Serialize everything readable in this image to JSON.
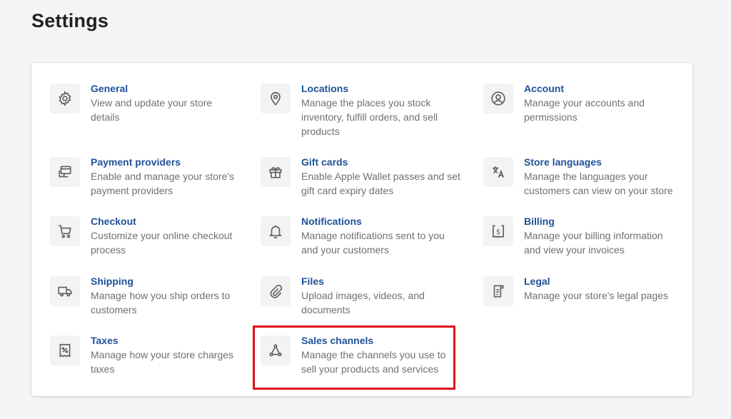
{
  "page": {
    "title": "Settings"
  },
  "columns": [
    [
      {
        "key": "general",
        "icon": "gear-icon",
        "title": "General",
        "desc": [
          "View and update your store",
          "details"
        ]
      },
      {
        "key": "payment-providers",
        "icon": "payment-icon",
        "title": "Payment providers",
        "desc": [
          "Enable and manage your store's",
          "payment providers"
        ]
      },
      {
        "key": "checkout",
        "icon": "cart-icon",
        "title": "Checkout",
        "desc": [
          "Customize your online checkout",
          "process"
        ]
      },
      {
        "key": "shipping",
        "icon": "truck-icon",
        "title": "Shipping",
        "desc": [
          "Manage how you ship orders to",
          "customers"
        ]
      },
      {
        "key": "taxes",
        "icon": "tax-receipt-icon",
        "title": "Taxes",
        "desc": [
          "Manage how your store charges",
          "taxes"
        ]
      }
    ],
    [
      {
        "key": "locations",
        "icon": "location-pin-icon",
        "title": "Locations",
        "desc": [
          "Manage the places you stock",
          "inventory, fulfill orders, and sell",
          "products"
        ]
      },
      {
        "key": "gift-cards",
        "icon": "gift-icon",
        "title": "Gift cards",
        "desc": [
          "Enable Apple Wallet passes and set",
          "gift card expiry dates"
        ]
      },
      {
        "key": "notifications",
        "icon": "bell-icon",
        "title": "Notifications",
        "desc": [
          "Manage notifications sent to you",
          "and your customers"
        ]
      },
      {
        "key": "files",
        "icon": "paperclip-icon",
        "title": "Files",
        "desc": [
          "Upload images, videos, and",
          "documents"
        ]
      },
      {
        "key": "sales-channels",
        "icon": "channels-icon",
        "title": "Sales channels",
        "desc": [
          "Manage the channels you use to",
          "sell your products and services"
        ]
      }
    ],
    [
      {
        "key": "account",
        "icon": "user-icon",
        "title": "Account",
        "desc": [
          "Manage your accounts and",
          "permissions"
        ]
      },
      {
        "key": "store-languages",
        "icon": "translate-icon",
        "title": "Store languages",
        "desc": [
          "Manage the languages your",
          "customers can view on your store"
        ]
      },
      {
        "key": "billing",
        "icon": "billing-icon",
        "title": "Billing",
        "desc": [
          "Manage your billing information",
          "and view your invoices"
        ]
      },
      {
        "key": "legal",
        "icon": "legal-document-icon",
        "title": "Legal",
        "desc": [
          "Manage your store's legal pages"
        ]
      }
    ]
  ],
  "highlight": {
    "target": "sales-channels",
    "color": "#e3121c"
  },
  "colors": {
    "link": "#1f5199",
    "muted": "#6d7175",
    "icon_bg": "#f2f3f4"
  }
}
